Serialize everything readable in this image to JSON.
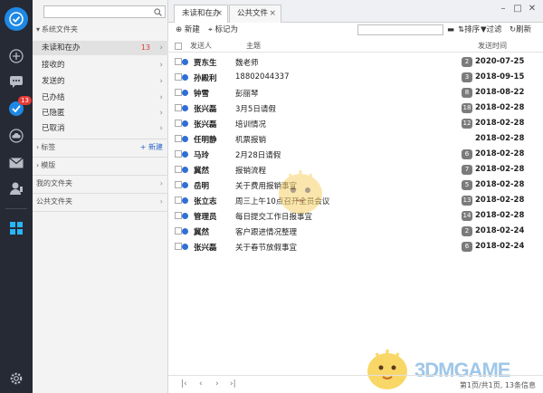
{
  "sidebar": {
    "system_folders": "系统文件夹",
    "folders": [
      {
        "label": "未读和在办",
        "count": "13"
      },
      {
        "label": "接收的",
        "count": ""
      },
      {
        "label": "发送的",
        "count": ""
      },
      {
        "label": "已办结",
        "count": ""
      },
      {
        "label": "已隐匿",
        "count": ""
      },
      {
        "label": "已取消",
        "count": ""
      }
    ],
    "tags": "标签",
    "tags_new": "+ 新建",
    "templates": "模版",
    "my_folders": "我的文件夹",
    "public_folders": "公共文件夹"
  },
  "rail": {
    "badge": "13"
  },
  "tabs": [
    {
      "label": "未读和在办"
    },
    {
      "label": "公共文件"
    }
  ],
  "toolbar": {
    "new_label": "新建",
    "mark_label": "标记为",
    "sort_label": "排序",
    "filter_label": "过滤",
    "refresh_label": "刷新"
  },
  "table": {
    "headers": {
      "sender": "发送人",
      "subject": "主题",
      "date": "发送时间"
    },
    "rows": [
      {
        "sender": "贾东生",
        "subject": "魏老师",
        "num": "2",
        "date": "2020-07-25"
      },
      {
        "sender": "孙殿利",
        "subject": "18802044337",
        "num": "3",
        "date": "2018-09-15"
      },
      {
        "sender": "钟雪",
        "subject": "彭丽琴",
        "num": "8",
        "date": "2018-08-22"
      },
      {
        "sender": "张兴磊",
        "subject": "3月5日请假",
        "num": "18",
        "date": "2018-02-28"
      },
      {
        "sender": "张兴磊",
        "subject": "培训情况",
        "num": "12",
        "date": "2018-02-28"
      },
      {
        "sender": "任明静",
        "subject": "机票报销",
        "num": "",
        "date": "2018-02-28"
      },
      {
        "sender": "马玲",
        "subject": "2月28日请假",
        "num": "6",
        "date": "2018-02-28"
      },
      {
        "sender": "冀然",
        "subject": "报销流程",
        "num": "7",
        "date": "2018-02-28"
      },
      {
        "sender": "岳明",
        "subject": "关于费用报销事宜",
        "num": "5",
        "date": "2018-02-28"
      },
      {
        "sender": "张立志",
        "subject": "周三上午10点召开全员会议",
        "num": "13",
        "date": "2018-02-28"
      },
      {
        "sender": "管理员",
        "subject": "每日提交工作日报事宜",
        "num": "14",
        "date": "2018-02-28"
      },
      {
        "sender": "冀然",
        "subject": "客户跟进情况整理",
        "num": "2",
        "date": "2018-02-24"
      },
      {
        "sender": "张兴磊",
        "subject": "关于春节放假事宜",
        "num": "6",
        "date": "2018-02-24"
      }
    ]
  },
  "pager": {
    "info": "第1页/共1页, 13条信息"
  },
  "watermark": "3DMGAME"
}
